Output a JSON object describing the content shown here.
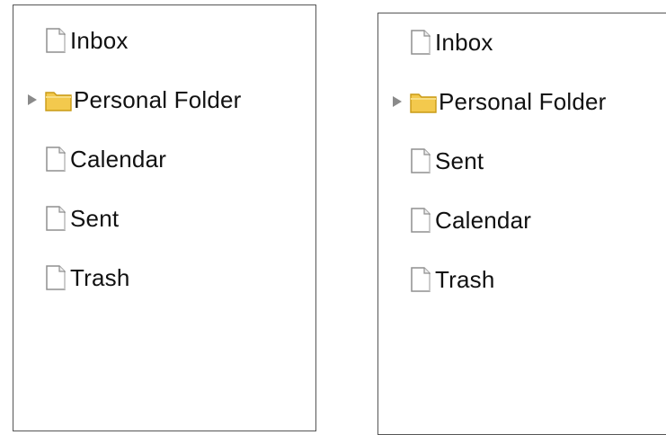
{
  "panels": [
    {
      "items": [
        {
          "label": "Inbox",
          "icon": "document-icon",
          "expandable": false
        },
        {
          "label": "Personal Folder",
          "icon": "folder-icon",
          "expandable": true
        },
        {
          "label": "Calendar",
          "icon": "document-icon",
          "expandable": false
        },
        {
          "label": "Sent",
          "icon": "document-icon",
          "expandable": false
        },
        {
          "label": "Trash",
          "icon": "document-icon",
          "expandable": false
        }
      ]
    },
    {
      "items": [
        {
          "label": "Inbox",
          "icon": "document-icon",
          "expandable": false
        },
        {
          "label": "Personal Folder",
          "icon": "folder-icon",
          "expandable": true
        },
        {
          "label": "Sent",
          "icon": "document-icon",
          "expandable": false
        },
        {
          "label": "Calendar",
          "icon": "document-icon",
          "expandable": false
        },
        {
          "label": "Trash",
          "icon": "document-icon",
          "expandable": false
        }
      ]
    }
  ],
  "colors": {
    "border": "#555555",
    "text": "#111111",
    "folder_fill": "#f3c94d",
    "folder_edge": "#c99a15",
    "expander_arrow": "#8a8a8a"
  }
}
